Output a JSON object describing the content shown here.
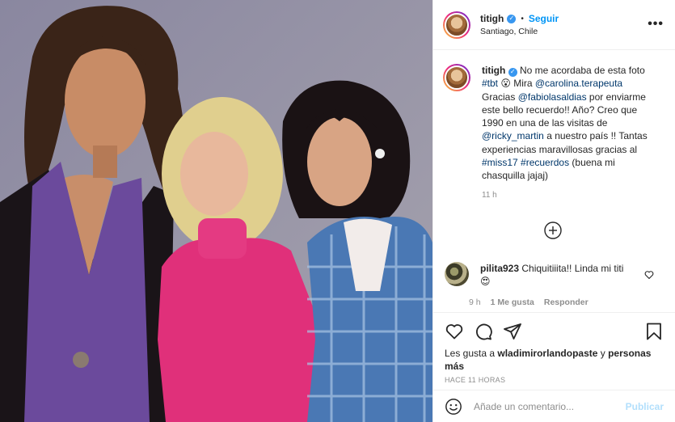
{
  "header": {
    "username": "titigh",
    "separator": "•",
    "follow_label": "Seguir",
    "location": "Santiago, Chile",
    "more_label": "•••"
  },
  "caption": {
    "username": "titigh",
    "text_1": " No me acordaba de esta foto ",
    "tag_tbt": "#tbt",
    "text_2": " 😮 Mira ",
    "mention_carolina": "@carolina.terapeuta",
    "text_3": " Gracias ",
    "mention_fabiola": "@fabiolasaldias",
    "text_4": " por enviarme este bello recuerdo!! Año? Creo que 1990 en una de las visitas de ",
    "mention_ricky": "@ricky_martin",
    "text_5": " a nuestro país !! Tantas experiencias maravillosas gracias al ",
    "tag_miss17": "#miss17",
    "text_6": " ",
    "tag_recuerdos": "#recuerdos",
    "text_7": " (buena mi chasquilla jajaj)",
    "time": "11 h"
  },
  "comment": {
    "username": "pilita923",
    "text": " Chiquitiiita!! Linda mi titi😍",
    "time": "9 h",
    "likes": "1 Me gusta",
    "reply": "Responder"
  },
  "actions": {
    "likes_prefix": "Les gusta a ",
    "likes_user": "wladimirorlandopaste",
    "likes_mid": " y ",
    "likes_others": "personas más",
    "posted_ago": "HACE 11 HORAS"
  },
  "add_comment": {
    "placeholder": "Añade un comentario...",
    "publish_label": "Publicar"
  },
  "colors": {
    "accent": "#0095f6",
    "link": "#00376b",
    "muted": "#8e8e8e",
    "publish_disabled": "#b2dffc"
  }
}
